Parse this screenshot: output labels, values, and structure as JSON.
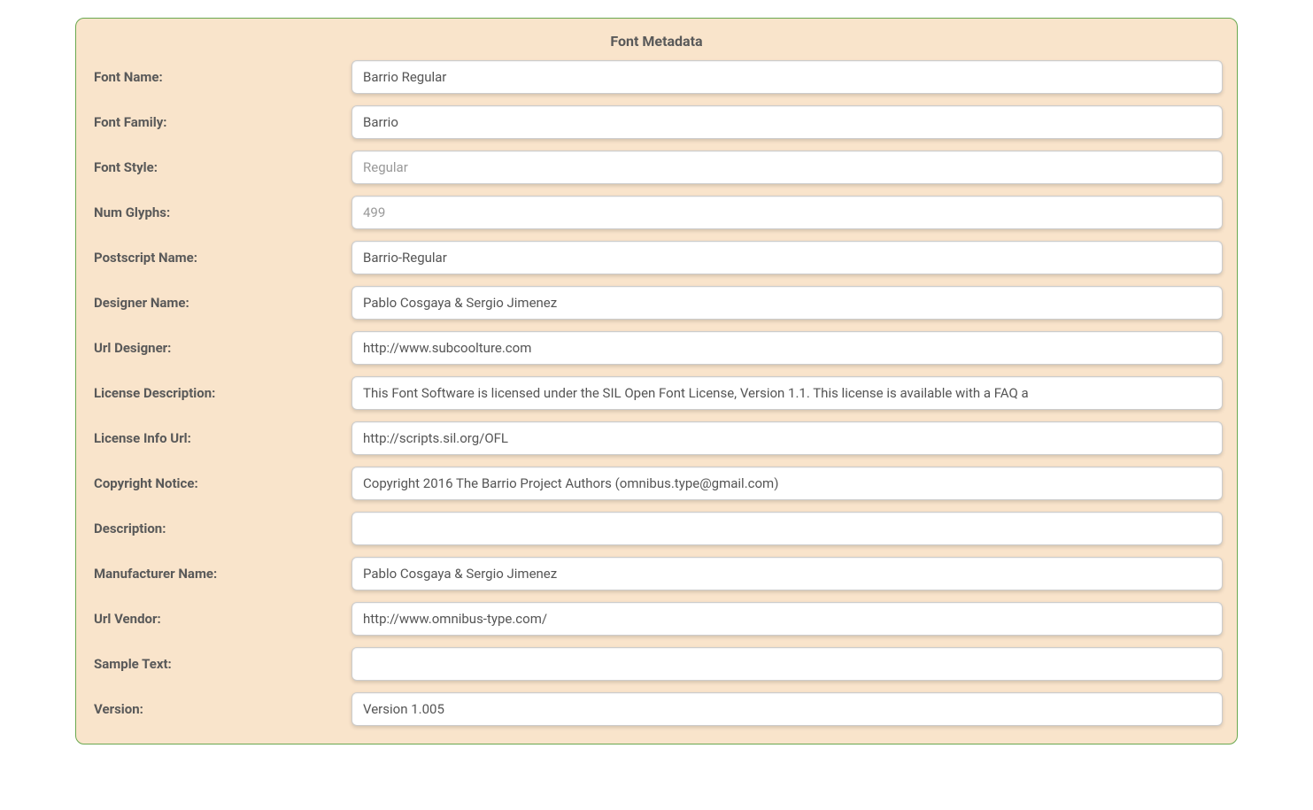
{
  "panel": {
    "title": "Font Metadata"
  },
  "fields": {
    "font_name": {
      "label": "Font Name:",
      "value": "Barrio Regular",
      "readonly": false
    },
    "font_family": {
      "label": "Font Family:",
      "value": "Barrio",
      "readonly": false
    },
    "font_style": {
      "label": "Font Style:",
      "value": "Regular",
      "readonly": true
    },
    "num_glyphs": {
      "label": "Num Glyphs:",
      "value": "499",
      "readonly": true
    },
    "postscript_name": {
      "label": "Postscript Name:",
      "value": "Barrio-Regular",
      "readonly": false
    },
    "designer_name": {
      "label": "Designer Name:",
      "value": "Pablo Cosgaya & Sergio Jimenez",
      "readonly": false
    },
    "url_designer": {
      "label": "Url Designer:",
      "value": "http://www.subcoolture.com",
      "readonly": false
    },
    "license_description": {
      "label": "License Description:",
      "value": "This Font Software is licensed under the SIL Open Font License, Version 1.1. This license is available with a FAQ a",
      "readonly": false
    },
    "license_info_url": {
      "label": "License Info Url:",
      "value": "http://scripts.sil.org/OFL",
      "readonly": false
    },
    "copyright_notice": {
      "label": "Copyright Notice:",
      "value": "Copyright 2016 The Barrio Project Authors (omnibus.type@gmail.com)",
      "readonly": false
    },
    "description": {
      "label": "Description:",
      "value": "",
      "readonly": false
    },
    "manufacturer_name": {
      "label": "Manufacturer Name:",
      "value": "Pablo Cosgaya & Sergio Jimenez",
      "readonly": false
    },
    "url_vendor": {
      "label": "Url Vendor:",
      "value": "http://www.omnibus-type.com/",
      "readonly": false
    },
    "sample_text": {
      "label": "Sample Text:",
      "value": "",
      "readonly": false
    },
    "version": {
      "label": "Version:",
      "value": "Version 1.005",
      "readonly": false
    }
  }
}
